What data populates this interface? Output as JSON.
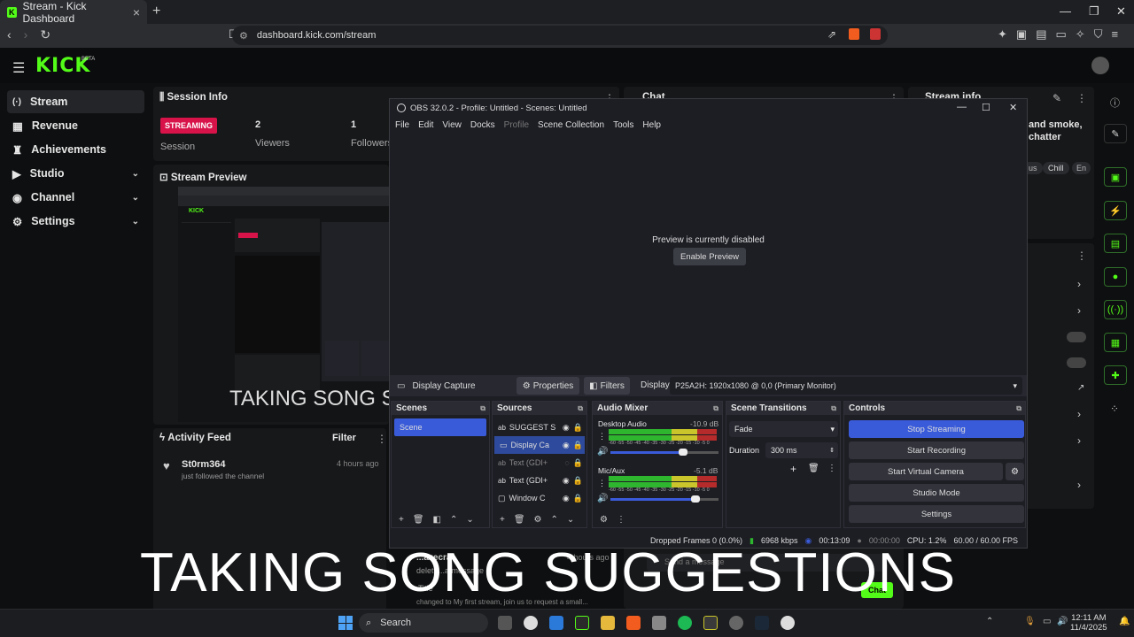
{
  "browser": {
    "tab_title": "Stream - Kick Dashboard",
    "favicon_letter": "K",
    "url": "dashboard.kick.com/stream",
    "new_tab_icon": "plus-icon"
  },
  "header": {
    "logo": "KICK",
    "logo_badge": "BETA"
  },
  "sidebar": {
    "items": [
      {
        "label": "Stream",
        "icon": "stream-icon"
      },
      {
        "label": "Revenue",
        "icon": "revenue-icon"
      },
      {
        "label": "Achievements",
        "icon": "trophy-icon"
      },
      {
        "label": "Studio",
        "icon": "studio-icon"
      },
      {
        "label": "Channel",
        "icon": "channel-icon"
      },
      {
        "label": "Settings",
        "icon": "gear-icon"
      }
    ]
  },
  "session": {
    "title": "Session Info",
    "status": "STREAMING",
    "status_label": "Session",
    "viewers_value": "2",
    "viewers_label": "Viewers",
    "followers_value": "1",
    "followers_label": "Followers"
  },
  "chat": {
    "title": "Chat"
  },
  "stream_info": {
    "title": "Stream info",
    "text1": "and smoke,",
    "text2": "chatter",
    "tags": [
      "us",
      "Chill",
      "En"
    ]
  },
  "preview": {
    "title": "Stream Preview",
    "overlay_text": "TAKING SONG S"
  },
  "activity": {
    "title": "Activity Feed",
    "filter": "Filter",
    "user": "St0rm364",
    "action": "just followed the channel",
    "time": "4 hours ago",
    "user2": "...azecraf",
    "action2": "delete...a message",
    "time2": "4 hours ago",
    "title_label": "Title",
    "change_text": "changed to My first stream, join us to request a small...",
    "chat_placeholder": "Send a message",
    "chat_button": "Chat"
  },
  "obs": {
    "title": "OBS 32.0.2 - Profile: Untitled - Scenes: Untitled",
    "menu": [
      "File",
      "Edit",
      "View",
      "Docks",
      "Profile",
      "Scene Collection",
      "Tools",
      "Help"
    ],
    "preview_disabled": "Preview is currently disabled",
    "enable_preview": "Enable Preview",
    "source_name": "Display Capture",
    "properties": "Properties",
    "filters": "Filters",
    "display_label": "Display",
    "display_value": "P25A2H: 1920x1080 @ 0,0 (Primary Monitor)",
    "scenes_title": "Scenes",
    "scenes": [
      "Scene"
    ],
    "sources_title": "Sources",
    "sources": [
      "SUGGEST S",
      "Display Ca",
      "Text (GDI+",
      "Text (GDI+",
      "Window C"
    ],
    "mixer_title": "Audio Mixer",
    "mixer": [
      {
        "name": "Desktop Audio",
        "db": "-10.9 dB"
      },
      {
        "name": "Mic/Aux",
        "db": "-5.1 dB"
      }
    ],
    "meter_scale": "-60 -55 -50 -45 -40 -35 -30 -25 -20 -15 -10 -5 0",
    "transitions_title": "Scene Transitions",
    "transition": "Fade",
    "duration_label": "Duration",
    "duration_value": "300 ms",
    "controls_title": "Controls",
    "controls": [
      "Stop Streaming",
      "Start Recording",
      "Start Virtual Camera",
      "Studio Mode",
      "Settings"
    ],
    "dropped_frames": "Dropped Frames 0 (0.0%)",
    "bitrate": "6968 kbps",
    "stream_time": "00:13:09",
    "rec_time": "00:00:00",
    "cpu": "CPU: 1.2%",
    "fps": "60.00 / 60.00 FPS"
  },
  "caption": "TAKING SONG SUGGESTIONS",
  "taskbar": {
    "search": "Search",
    "time": "12:11 AM",
    "date": "11/4/2025"
  },
  "colors": {
    "kick_green": "#53fc18",
    "streaming_red": "#d8134a",
    "obs_blue": "#3a5bd9"
  }
}
